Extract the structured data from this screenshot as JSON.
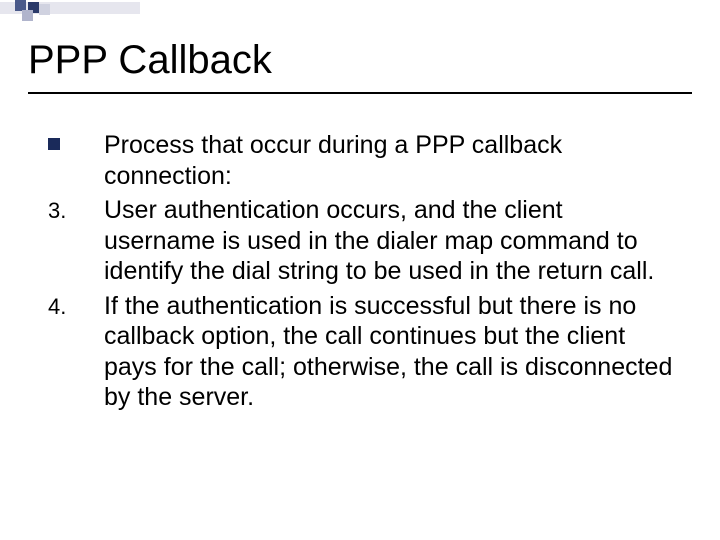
{
  "title": "PPP Callback",
  "items": [
    {
      "marker_type": "square",
      "marker": "",
      "text": "Process that occur during a PPP callback connection:"
    },
    {
      "marker_type": "number",
      "marker": "3.",
      "text": "User authentication occurs, and the client username is used in the dialer map command to identify the dial string to be used in the return call."
    },
    {
      "marker_type": "number",
      "marker": "4.",
      "text": "If the authentication is successful but there is no callback option, the call continues but the client pays for the call; otherwise, the call is disconnected by the server."
    }
  ]
}
